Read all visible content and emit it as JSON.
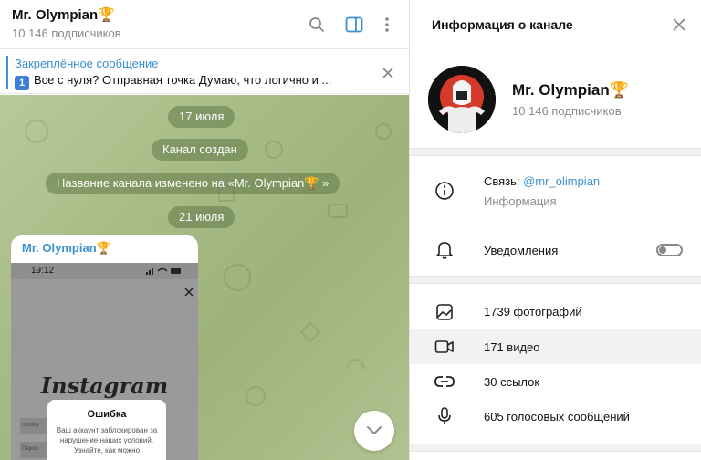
{
  "chat": {
    "title": "Mr. Olympian",
    "title_emoji": "🏆",
    "subscribers": "10 146 подписчиков",
    "pinned": {
      "title": "Закреплённое сообщение",
      "badge": "1",
      "text": "Все с нуля? Отправная точка   Думаю, что логично и ..."
    },
    "service_messages": [
      "17 июля",
      "Канал создан",
      "Название канала изменено на «Mr. Olympian🏆 »",
      "21 июля"
    ],
    "post": {
      "author": "Mr. Olympian",
      "author_emoji": "🏆",
      "screenshot": {
        "time": "19:12",
        "app_logo": "Instagram",
        "field_1": "mrolim",
        "field_2": "Парол",
        "dialog_title": "Ошибка",
        "dialog_text": "Ваш аккаунт заблокирован за нарушение наших условий. Узнайте, как можно"
      }
    },
    "icons": [
      "search-icon",
      "sidebar-toggle-icon",
      "more-vertical-icon",
      "close-icon",
      "chevron-down-icon"
    ]
  },
  "info": {
    "header_title": "Информация о канале",
    "channel_name": "Mr. Olympian",
    "channel_emoji": "🏆",
    "subscribers": "10 146 подписчиков",
    "contact_label": "Связь: ",
    "contact_link": "@mr_olimpian",
    "contact_sub": "Информация",
    "notifications_label": "Уведомления",
    "notifications_enabled": false,
    "media": [
      {
        "label": "1739 фотографий",
        "icon": "photo-icon"
      },
      {
        "label": "171 видео",
        "icon": "video-icon"
      },
      {
        "label": "30 ссылок",
        "icon": "link-icon"
      },
      {
        "label": "605 голосовых сообщений",
        "icon": "microphone-icon"
      }
    ]
  },
  "colors": {
    "accent": "#3a8fd0",
    "wallpaper": "#a6bb85",
    "service_pill": "#607848"
  }
}
